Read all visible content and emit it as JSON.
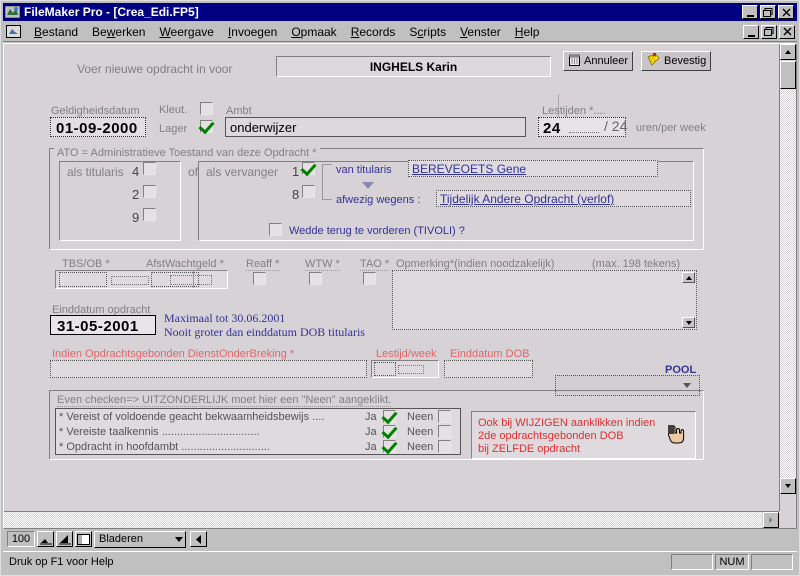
{
  "window": {
    "title": "FileMaker Pro - [Crea_Edi.FP5]",
    "app_icon": "filemaker-icon",
    "min_label": "_",
    "restore_label": "❐",
    "close_label": "✕"
  },
  "menubar": {
    "doc_icon": "document-control-icon",
    "items": [
      {
        "label": "Bestand",
        "accel": "B"
      },
      {
        "label": "Bewerken",
        "accel": "w"
      },
      {
        "label": "Weergave",
        "accel": "W"
      },
      {
        "label": "Invoegen",
        "accel": "I"
      },
      {
        "label": "Opmaak",
        "accel": "O"
      },
      {
        "label": "Records",
        "accel": "R"
      },
      {
        "label": "Scripts",
        "accel": "S"
      },
      {
        "label": "Venster",
        "accel": "V"
      },
      {
        "label": "Help",
        "accel": "H"
      }
    ]
  },
  "toolbar": {
    "cancel_label": "Annuleer",
    "cancel_icon": "trash-icon",
    "confirm_label": "Bevestig",
    "confirm_icon": "note-check-icon"
  },
  "header": {
    "prompt": "Voer nieuwe opdracht in voor",
    "person_name": "INGHELS  Karin"
  },
  "row_validity": {
    "date_label": "Geldigheidsdatum",
    "date_value": "01-09-2000",
    "kleut_label": "Kleut.",
    "kleut_checked": false,
    "lager_label": "Lager",
    "lager_checked": true,
    "ambt_label": "Ambt",
    "ambt_value": "onderwijzer",
    "lestijden_label": "Lestijden *....",
    "lestijden_value": "24",
    "lestijden_extra": "",
    "lestijden_divider": "/ 24",
    "lestijden_unit": "uren/per week"
  },
  "ato": {
    "section_title": "ATO = Administratieve Toestand van deze Opdracht *",
    "titularis_label": "als titularis",
    "titularis_options": [
      {
        "code": "4",
        "checked": false
      },
      {
        "code": "2",
        "checked": false
      },
      {
        "code": "9",
        "checked": false
      }
    ],
    "or_label": "of",
    "vervanger_label": "als vervanger",
    "vervanger_options": [
      {
        "code": "1",
        "checked": true
      },
      {
        "code": "8",
        "checked": false
      }
    ],
    "van_titularis_label": "van titularis",
    "van_titularis_value": "BEREVEOETS  Gene",
    "afwezig_label": "afwezig wegens :",
    "afwezig_value": "Tijdelijk Andere Opdracht (verlof)",
    "dropdown_icon": "chevron-down-icon",
    "wedde_label": "Wedde terug te vorderen (TIVOLI) ?",
    "wedde_checked": false
  },
  "flags_row": {
    "tbsob_label": "TBS/OB  *",
    "tbsob_value": "",
    "afstwacht_label": "AfstWachtgeld *",
    "afstwacht_value": "",
    "reaff_label": "Reaff *",
    "reaff_checked": false,
    "wtw_label": "WTW *",
    "wtw_checked": false,
    "tao_label": "TAO *",
    "tao_checked": false,
    "opmerking_label": "Opmerking*(indien noodzakelijk)",
    "opmerking_max": "(max. 198 tekens)",
    "opmerking_value": "",
    "opmerking_scroll_up_icon": "scroll-up-icon",
    "opmerking_scroll_down_icon": "scroll-down-icon"
  },
  "einddatum": {
    "label": "Einddatum opdracht",
    "value": "31-05-2001",
    "note_line1": "Maximaal tot 30.06.2001",
    "note_line2": "Nooit groter dan einddatum DOB titularis"
  },
  "dob": {
    "label": "Indien Opdrachtsgebonden DienstOnderBreking *",
    "value": "",
    "lestijd_label": "Lestijd/week",
    "lestijd_value": "",
    "einddatum_label": "Einddatum DOB",
    "einddatum_value": "",
    "pool_label": "POOL",
    "pool_value": "",
    "pool_icon": "chevron-down-icon"
  },
  "checklist": {
    "heading": "Even checken=> UITZONDERLIJK moet hier een \"Neen\" aangeklikt.",
    "ja_label": "Ja",
    "neen_label": "Neen",
    "rows": [
      {
        "text": "* Vereist of voldoende geacht bekwaamheidsbewijs ....",
        "underline": "bekwaamheidsbewijs",
        "ja": true,
        "neen": false
      },
      {
        "text": "* Vereiste taalkennis ................................",
        "underline": "taalkennis",
        "ja": true,
        "neen": false
      },
      {
        "text": "* Opdracht in hoofdambt .............................",
        "underline": "in hoofdambt",
        "ja": true,
        "neen": false
      }
    ]
  },
  "warning": {
    "line1": "Ook bij  WIJZIGEN  aanklikken indien",
    "line2": "2de opdrachtsgebonden DOB",
    "line3": "bij ZELFDE opdracht",
    "icon": "pointing-hand-icon"
  },
  "statusbar": {
    "zoom_level": "100",
    "zoom_out_icon": "zoom-out-icon",
    "zoom_in_icon": "zoom-in-icon",
    "status_area_icon": "toggle-statusarea-icon",
    "mode_value": "Bladeren",
    "mode_icon": "chevron-down-icon",
    "book_icon": "book-left-icon",
    "help_text": "Druk op F1 voor Help",
    "num_indicator": "NUM"
  },
  "colors": {
    "titlebar": "#000080",
    "face": "#c0c0c0",
    "canvas": "#d6d2d6",
    "label_gray": "#808080",
    "accent_blue": "#333399",
    "accent_red": "#e03030",
    "pink_red": "#e06666",
    "check_green": "#008000"
  }
}
